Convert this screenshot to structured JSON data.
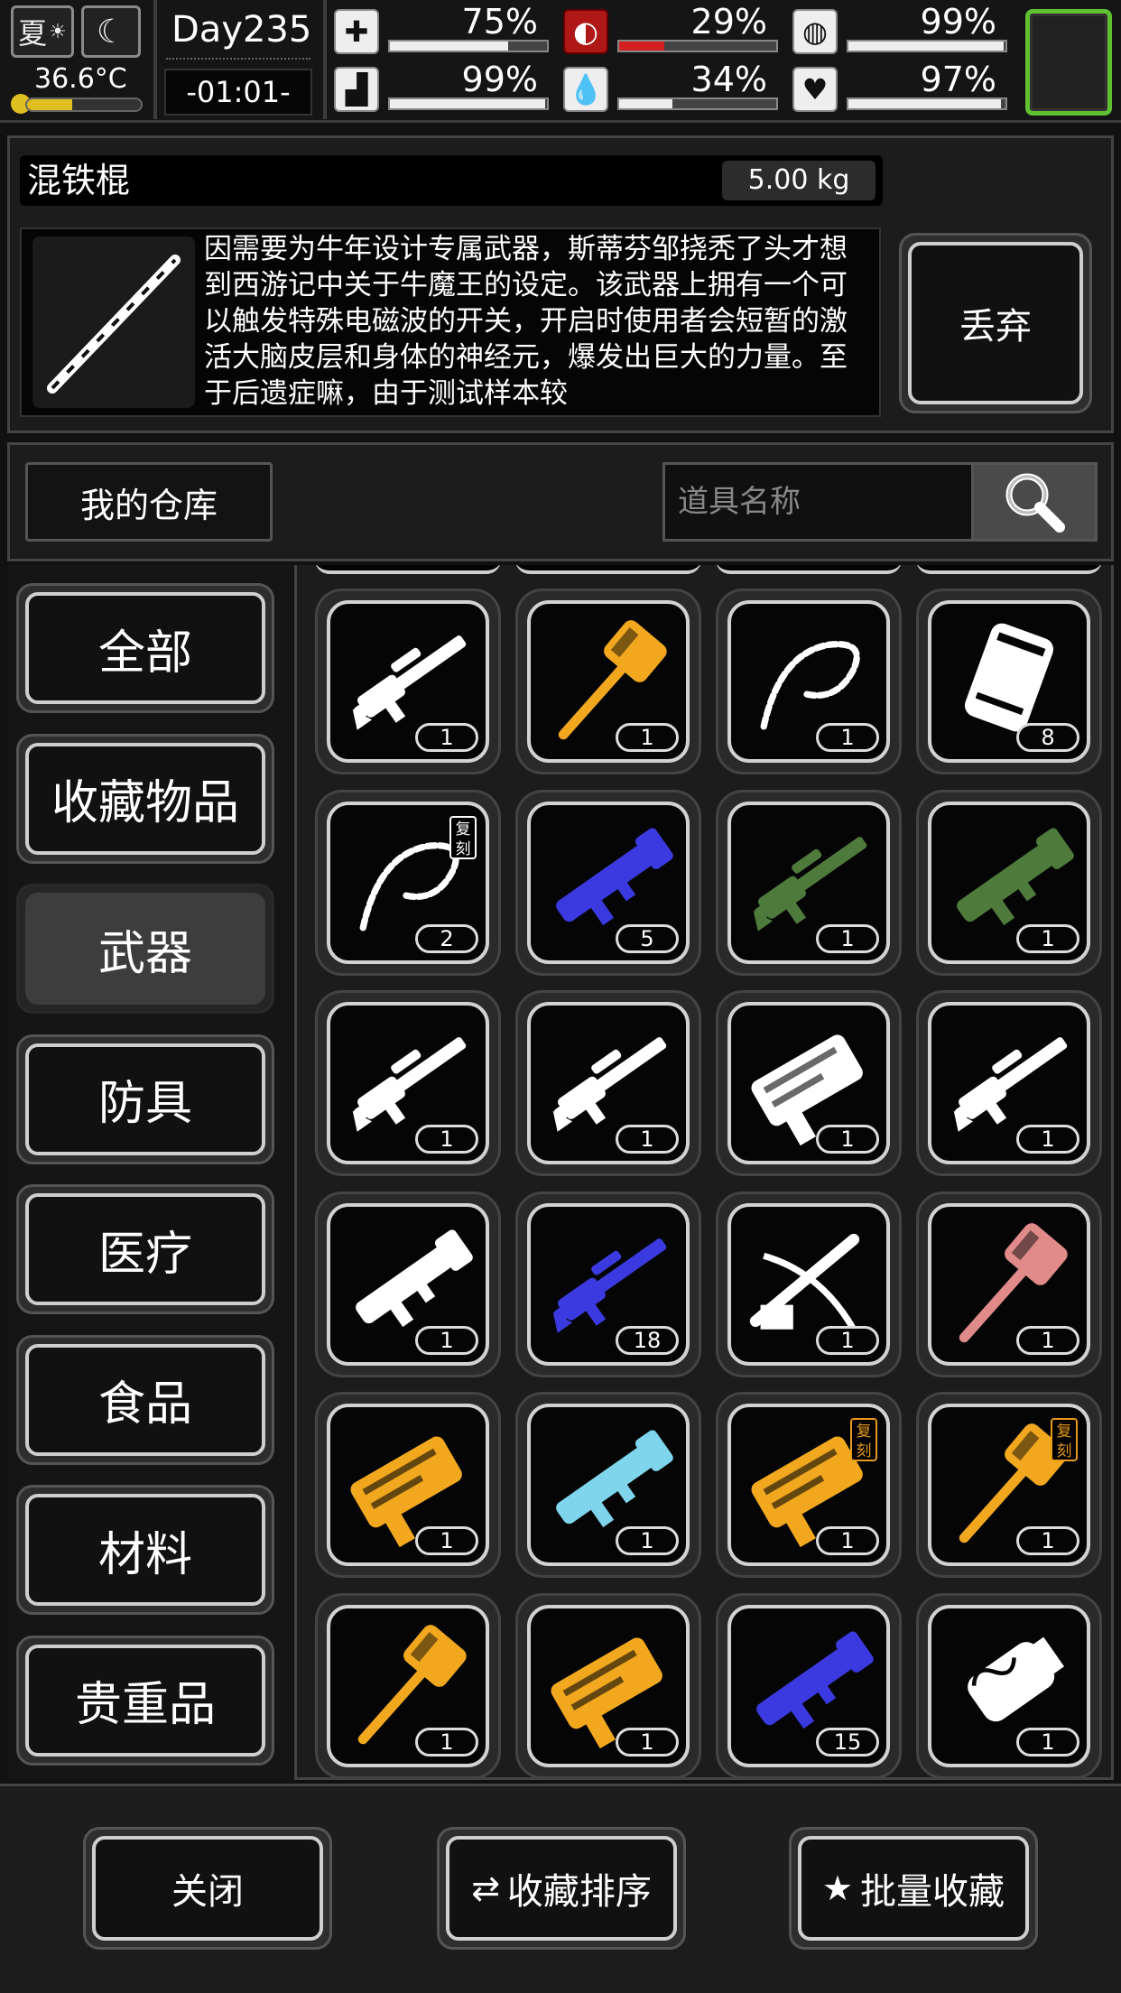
{
  "status_bar": {
    "season": "夏",
    "season_icon": "sun-weather-icon",
    "night_icon": "moon-icon",
    "temperature": "36.6°C",
    "temperature_level": 0.4,
    "day": "Day235",
    "time": "-01:01-",
    "stats": [
      {
        "name": "health",
        "icon": "medkit-icon",
        "value": "75%",
        "level": 0.75,
        "color": "#eeeeee"
      },
      {
        "name": "hunger",
        "icon": "stomach-icon",
        "value": "29%",
        "level": 0.29,
        "color": "#d52020"
      },
      {
        "name": "sanity",
        "icon": "brain-icon",
        "value": "99%",
        "level": 0.99,
        "color": "#eeeeee"
      },
      {
        "name": "stamina",
        "icon": "boot-icon",
        "value": "99%",
        "level": 0.99,
        "color": "#eeeeee"
      },
      {
        "name": "thirst",
        "icon": "water-drop-icon",
        "value": "34%",
        "level": 0.34,
        "color": "#eeeeee"
      },
      {
        "name": "mood",
        "icon": "heart-icon",
        "value": "97%",
        "level": 0.97,
        "color": "#eeeeee"
      }
    ]
  },
  "item_detail": {
    "name": "混铁棍",
    "weight": "5.00 kg",
    "description": "因需要为牛年设计专属武器，斯蒂芬邹挠秃了头才想到西游记中关于牛魔王的设定。该武器上拥有一个可以触发特殊电磁波的开关，开启时使用者会短暂的激活大脑皮层和身体的神经元，爆发出巨大的力量。至于后遗症嘛，由于测试样本较",
    "discard_label": "丢弃"
  },
  "warehouse": {
    "title": "我的仓库",
    "search_placeholder": "道具名称"
  },
  "categories": [
    {
      "label": "全部",
      "active": false
    },
    {
      "label": "收藏物品",
      "active": false
    },
    {
      "label": "武器",
      "active": true
    },
    {
      "label": "防具",
      "active": false
    },
    {
      "label": "医疗",
      "active": false
    },
    {
      "label": "食品",
      "active": false
    },
    {
      "label": "材料",
      "active": false
    },
    {
      "label": "贵重品",
      "active": false
    }
  ],
  "replica_tag": "复刻",
  "items": [
    {
      "icon": "white-dragon-rifle-icon",
      "count": "1",
      "color": "#ffffff",
      "replica": false
    },
    {
      "icon": "gold-dragon-hammer-icon",
      "count": "1",
      "color": "#f2a81e",
      "replica": false
    },
    {
      "icon": "white-chain-whip-icon",
      "count": "1",
      "color": "#ffffff",
      "replica": false
    },
    {
      "icon": "white-ammo-case-icon",
      "count": "8",
      "color": "#ffffff",
      "replica": false
    },
    {
      "icon": "white-chain-whip-icon",
      "count": "2",
      "color": "#ffffff",
      "replica": true,
      "replica_color": "#ffffff"
    },
    {
      "icon": "blue-rocket-launcher-icon",
      "count": "5",
      "color": "#3a3ae0",
      "replica": false
    },
    {
      "icon": "camo-sniper-rifle-icon",
      "count": "1",
      "color": "#4e7a3c",
      "replica": false
    },
    {
      "icon": "camo-rocket-launcher-icon",
      "count": "1",
      "color": "#4e7a3c",
      "replica": false
    },
    {
      "icon": "white-dragon-sniper-icon",
      "count": "1",
      "color": "#ffffff",
      "replica": false
    },
    {
      "icon": "white-dragon-machinegun-icon",
      "count": "1",
      "color": "#ffffff",
      "replica": false
    },
    {
      "icon": "white-dragon-blaster-icon",
      "count": "1",
      "color": "#ffffff",
      "replica": false
    },
    {
      "icon": "white-dragon-lmg-icon",
      "count": "1",
      "color": "#ffffff",
      "replica": false
    },
    {
      "icon": "white-dragon-cannon-icon",
      "count": "1",
      "color": "#ffffff",
      "replica": false
    },
    {
      "icon": "blue-sniper-rifle-icon",
      "count": "18",
      "color": "#3a3ae0",
      "replica": false
    },
    {
      "icon": "white-crossbow-icon",
      "count": "1",
      "color": "#ffffff",
      "replica": false
    },
    {
      "icon": "pink-war-hammer-icon",
      "count": "1",
      "color": "#e08a8a",
      "replica": false
    },
    {
      "icon": "gold-ox-blaster-icon",
      "count": "1",
      "color": "#f2a81e",
      "replica": false
    },
    {
      "icon": "cyan-shotgun-icon",
      "count": "1",
      "color": "#7fd6ec",
      "replica": false
    },
    {
      "icon": "gold-ox-blaster-icon",
      "count": "1",
      "color": "#f2a81e",
      "replica": true,
      "replica_color": "#e89a1a"
    },
    {
      "icon": "gold-ox-hammer-icon",
      "count": "1",
      "color": "#f2a81e",
      "replica": true,
      "replica_color": "#e89a1a"
    },
    {
      "icon": "gold-ox-hammer-icon",
      "count": "1",
      "color": "#f2a81e",
      "replica": false
    },
    {
      "icon": "gold-ox-blaster-icon",
      "count": "1",
      "color": "#f2a81e",
      "replica": false
    },
    {
      "icon": "blue-minigun-icon",
      "count": "15",
      "color": "#3a3ae0",
      "replica": false
    },
    {
      "icon": "white-ornate-gauntlet-icon",
      "count": "1",
      "color": "#ffffff",
      "replica": false
    }
  ],
  "footer": {
    "close_label": "关闭",
    "sort_label": "收藏排序",
    "sort_icon": "swap-arrows-icon",
    "batch_label": "批量收藏",
    "batch_icon": "stars-icon"
  }
}
